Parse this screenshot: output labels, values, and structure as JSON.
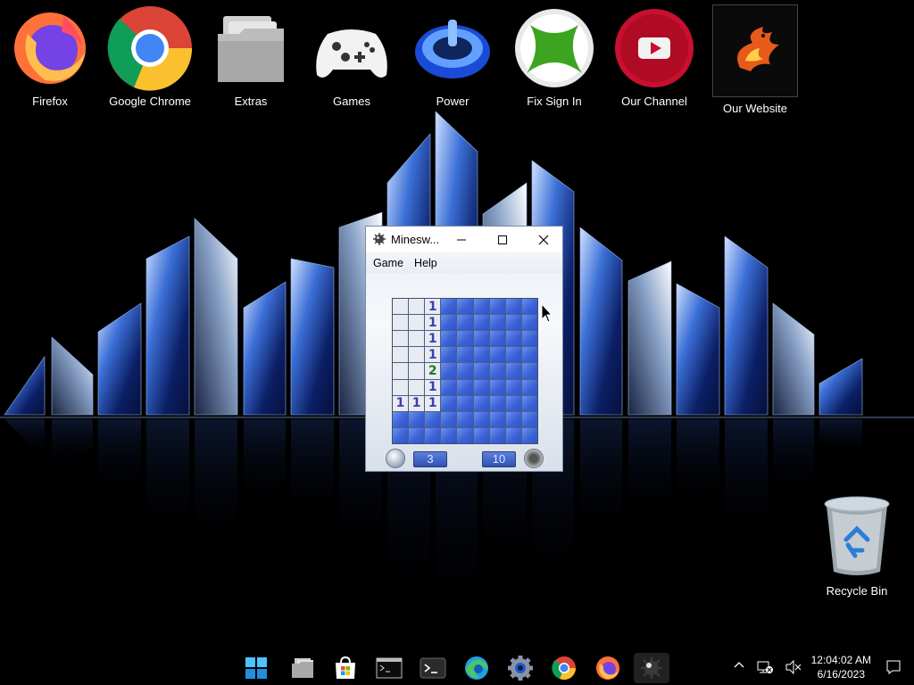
{
  "desktop": {
    "icons": [
      {
        "label": "Firefox",
        "icon": "firefox-icon"
      },
      {
        "label": "Google Chrome",
        "icon": "chrome-icon"
      },
      {
        "label": "Extras",
        "icon": "folder-icon"
      },
      {
        "label": "Games",
        "icon": "gamepad-icon"
      },
      {
        "label": "Power",
        "icon": "power-icon"
      },
      {
        "label": "Fix Sign In",
        "icon": "xbox-icon"
      },
      {
        "label": "Our Channel",
        "icon": "youtube-icon"
      },
      {
        "label": "Our Website",
        "icon": "phoenix-logo-icon"
      }
    ],
    "recycle_bin": {
      "label": "Recycle Bin",
      "icon": "recycle-bin-icon"
    }
  },
  "window": {
    "title": "Minesw...",
    "menu": [
      "Game",
      "Help"
    ],
    "board": [
      [
        " ",
        " ",
        "1",
        "#",
        "#",
        "#",
        "#",
        "#",
        "#"
      ],
      [
        " ",
        " ",
        "1",
        "#",
        "#",
        "#",
        "#",
        "#",
        "#"
      ],
      [
        " ",
        " ",
        "1",
        "#",
        "#",
        "#",
        "#",
        "#",
        "#"
      ],
      [
        " ",
        " ",
        "1",
        "#",
        "#",
        "#",
        "#",
        "#",
        "#"
      ],
      [
        " ",
        " ",
        "2",
        "#",
        "#",
        "#",
        "#",
        "#",
        "#"
      ],
      [
        " ",
        " ",
        "1",
        "#",
        "#",
        "#",
        "#",
        "#",
        "#"
      ],
      [
        "1",
        "1",
        "1",
        "#",
        "#",
        "#",
        "#",
        "#",
        "#"
      ],
      [
        "#",
        "#",
        "#",
        "#",
        "#",
        "#",
        "#",
        "#",
        "#"
      ],
      [
        "#",
        "#",
        "#",
        "#",
        "#",
        "#",
        "#",
        "#",
        "#"
      ]
    ],
    "timer": "3",
    "mines_left": "10"
  },
  "taskbar": {
    "apps": [
      "start-icon",
      "file-explorer-icon",
      "store-icon",
      "cmd-icon",
      "terminal-icon",
      "edge-icon",
      "settings-icon",
      "chrome-icon",
      "firefox-icon",
      "minesweeper-icon"
    ],
    "active_app": "minesweeper-icon",
    "time": "12:04:02 AM",
    "date": "6/16/2023"
  },
  "colors": {
    "accent": "#3a63d8",
    "number_1": "#3c3fb0",
    "number_2": "#207a1f"
  }
}
